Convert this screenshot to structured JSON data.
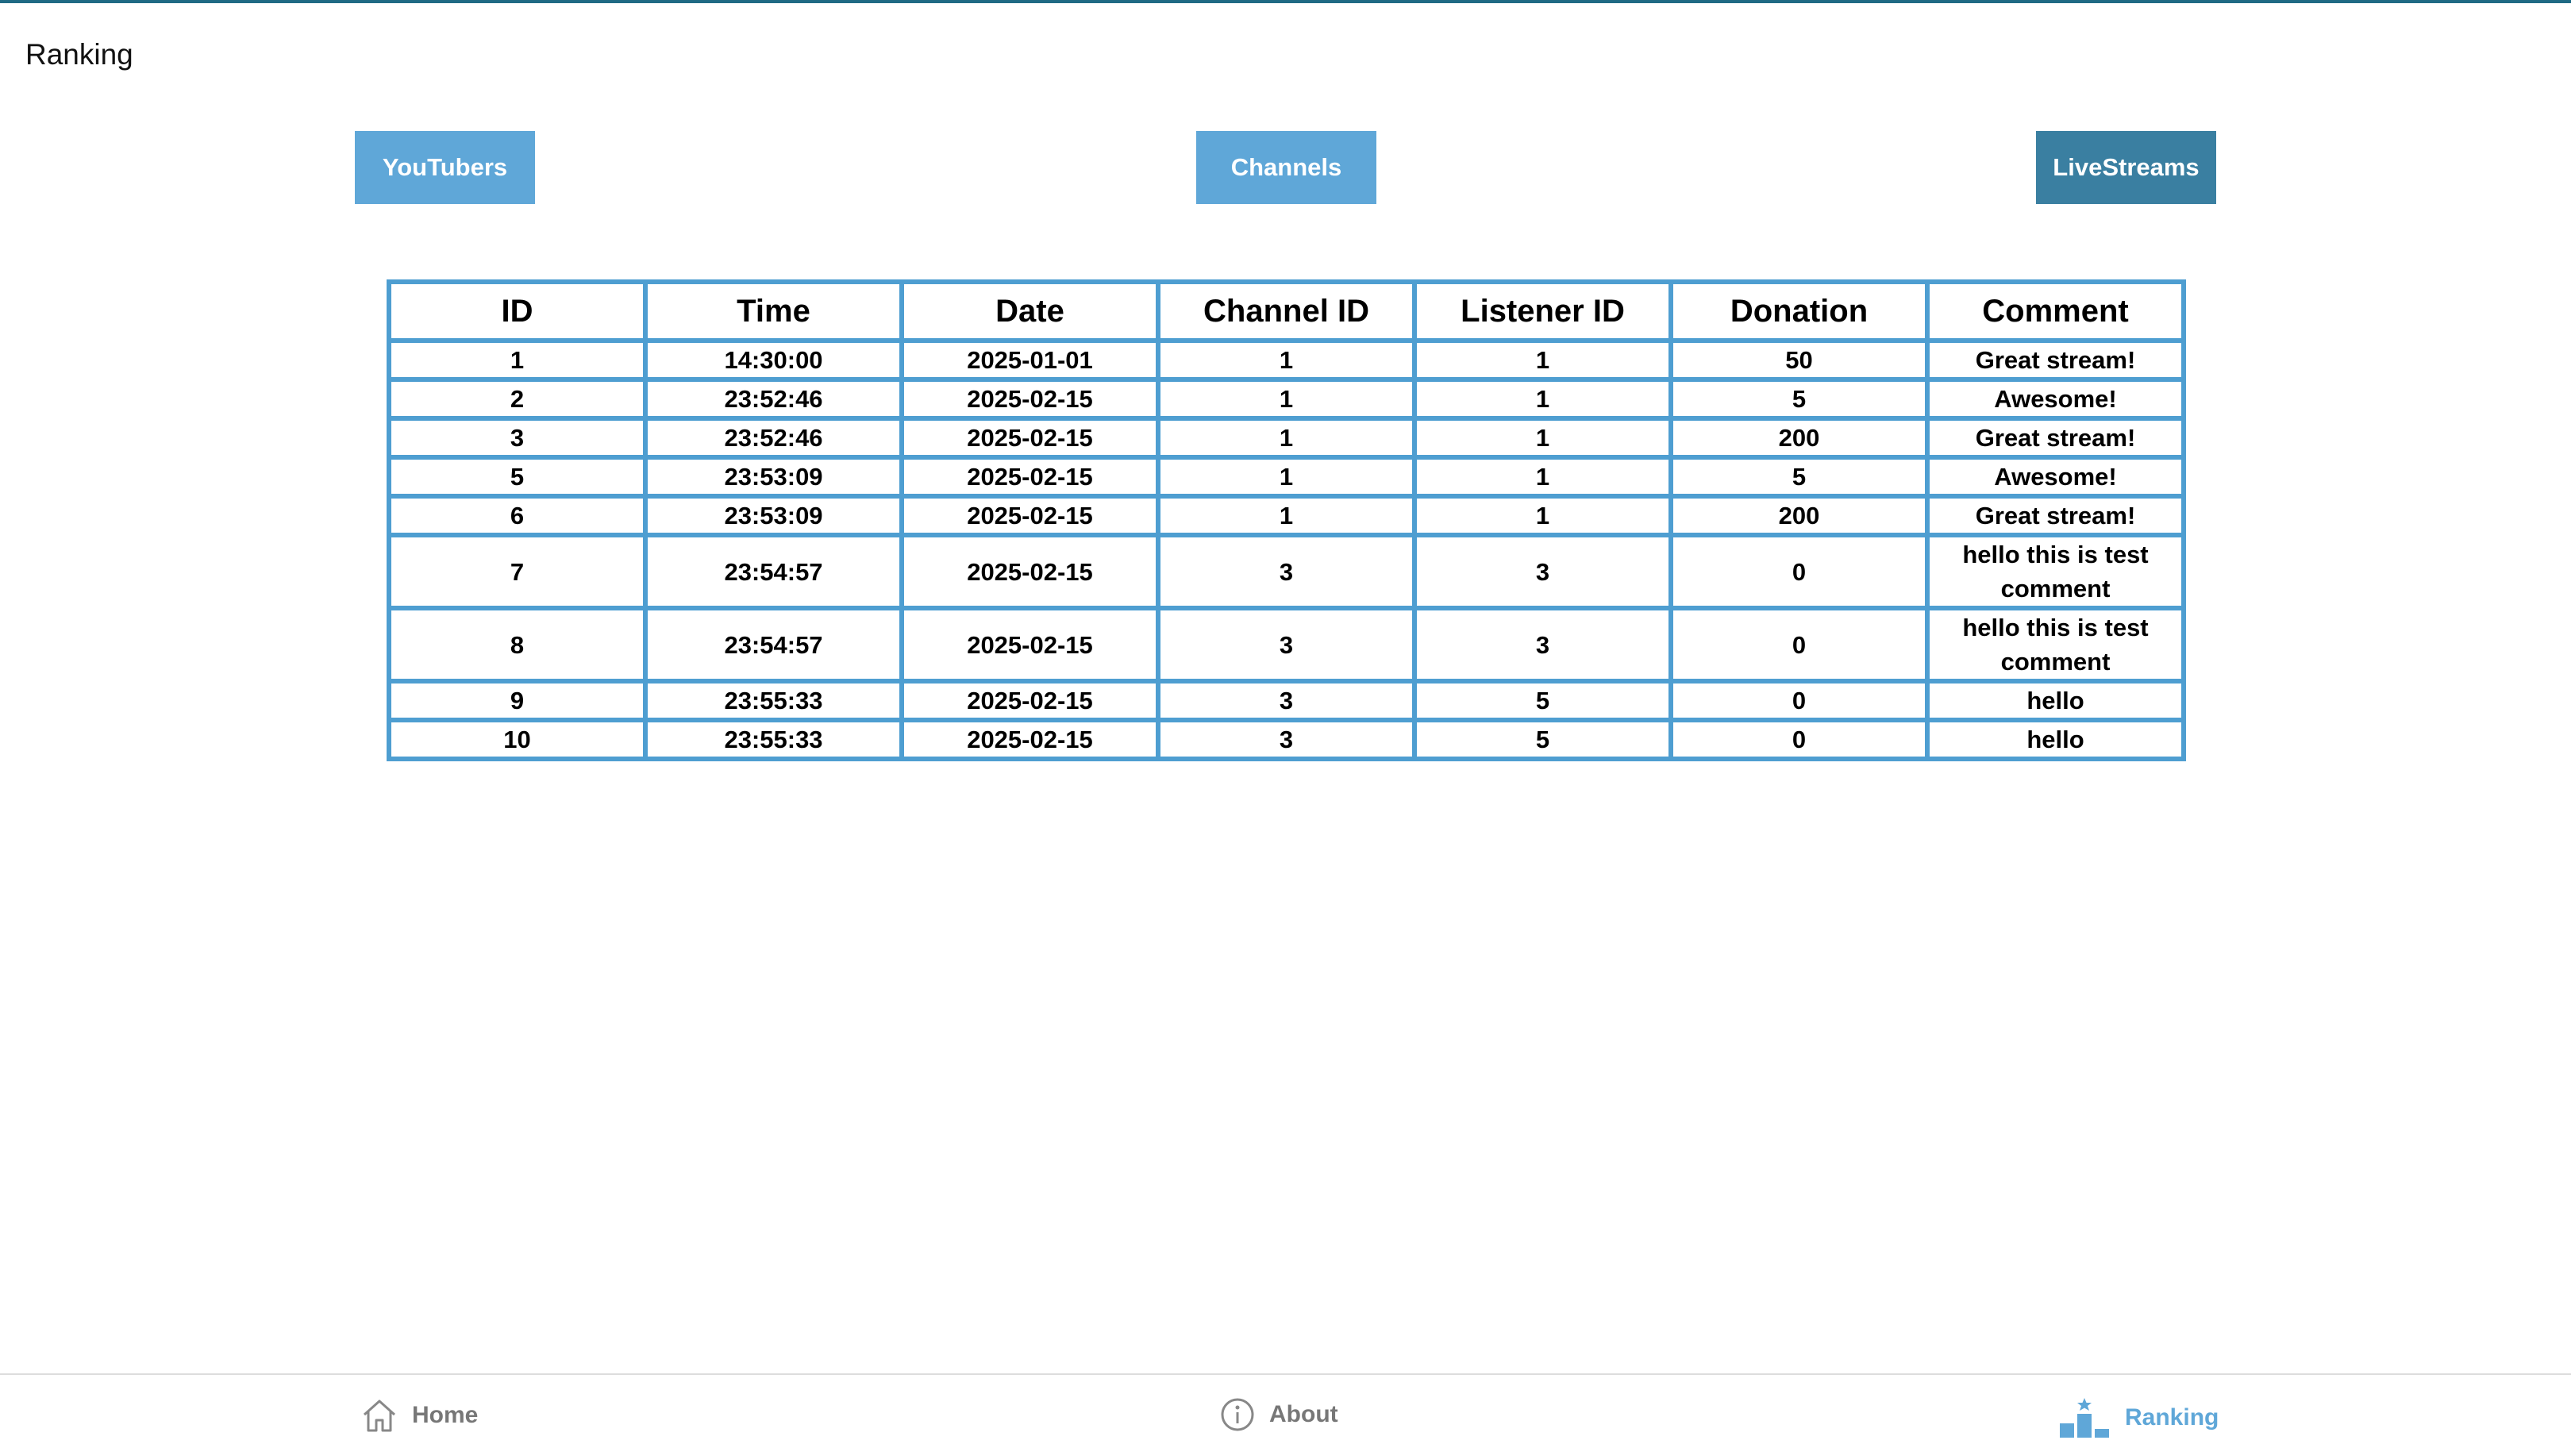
{
  "page": {
    "title": "Ranking"
  },
  "tabs": {
    "youtubers": "YouTubers",
    "channels": "Channels",
    "livestreams": "LiveStreams"
  },
  "table": {
    "headers": [
      "ID",
      "Time",
      "Date",
      "Channel ID",
      "Listener ID",
      "Donation",
      "Comment"
    ],
    "rows": [
      [
        "1",
        "14:30:00",
        "2025-01-01",
        "1",
        "1",
        "50",
        "Great stream!"
      ],
      [
        "2",
        "23:52:46",
        "2025-02-15",
        "1",
        "1",
        "5",
        "Awesome!"
      ],
      [
        "3",
        "23:52:46",
        "2025-02-15",
        "1",
        "1",
        "200",
        "Great stream!"
      ],
      [
        "5",
        "23:53:09",
        "2025-02-15",
        "1",
        "1",
        "5",
        "Awesome!"
      ],
      [
        "6",
        "23:53:09",
        "2025-02-15",
        "1",
        "1",
        "200",
        "Great stream!"
      ],
      [
        "7",
        "23:54:57",
        "2025-02-15",
        "3",
        "3",
        "0",
        "hello this is test comment"
      ],
      [
        "8",
        "23:54:57",
        "2025-02-15",
        "3",
        "3",
        "0",
        "hello this is test comment"
      ],
      [
        "9",
        "23:55:33",
        "2025-02-15",
        "3",
        "5",
        "0",
        "hello"
      ],
      [
        "10",
        "23:55:33",
        "2025-02-15",
        "3",
        "5",
        "0",
        "hello"
      ]
    ]
  },
  "nav": {
    "home": {
      "label": "Home",
      "icon": "home-icon"
    },
    "about": {
      "label": "About",
      "icon": "info-icon"
    },
    "ranking": {
      "label": "Ranking",
      "icon": "podium-icon"
    }
  },
  "colors": {
    "accent": "#5fa7d8",
    "accent_dark": "#3a7fa1",
    "table_border": "#4e9ed1",
    "top_bar": "#1f6a84"
  }
}
